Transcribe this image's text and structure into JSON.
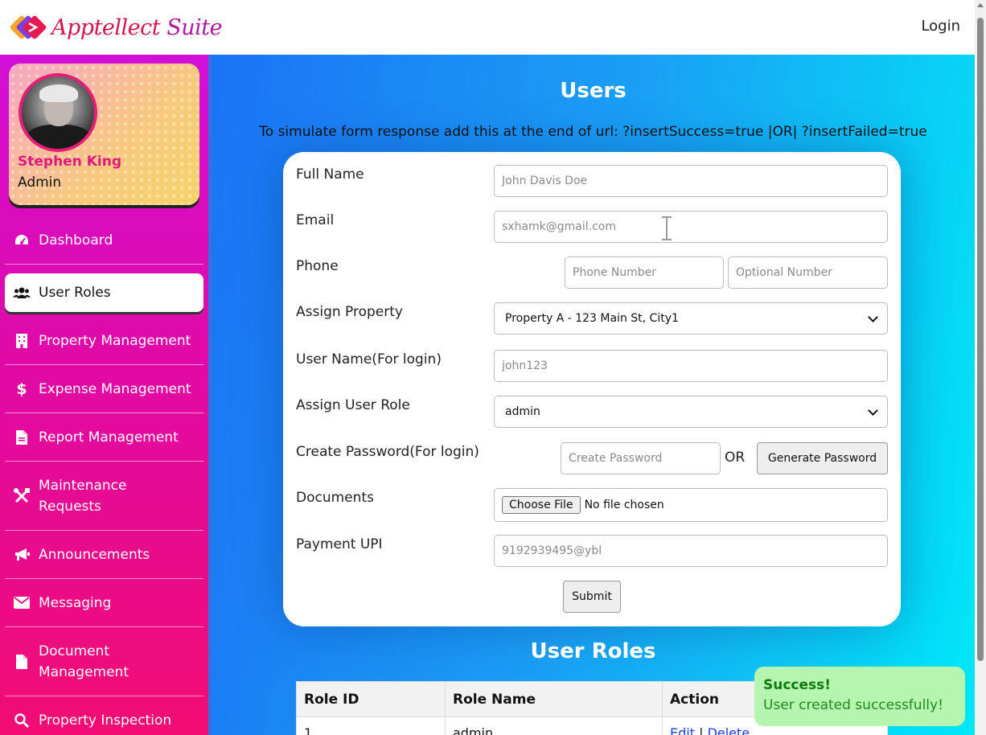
{
  "header": {
    "brand_main": "Apptellect",
    "brand_suite": "Suite",
    "login_label": "Login"
  },
  "profile": {
    "name": "Stephen King",
    "role": "Admin"
  },
  "sidebar": {
    "items": [
      {
        "label": "Dashboard",
        "icon": "gauge-icon",
        "active": false
      },
      {
        "label": "User Roles",
        "icon": "users-icon",
        "active": true
      },
      {
        "label": "Property Management",
        "icon": "building-icon",
        "active": false
      },
      {
        "label": "Expense Management",
        "icon": "dollar-icon",
        "active": false
      },
      {
        "label": "Report Management",
        "icon": "file-icon",
        "active": false
      },
      {
        "label": "Maintenance Requests",
        "icon": "tools-icon",
        "active": false
      },
      {
        "label": "Announcements",
        "icon": "megaphone-icon",
        "active": false
      },
      {
        "label": "Messaging",
        "icon": "envelope-icon",
        "active": false
      },
      {
        "label": "Document Management",
        "icon": "file-icon",
        "active": false
      },
      {
        "label": "Property Inspection",
        "icon": "search-icon",
        "active": false
      }
    ]
  },
  "main": {
    "title": "Users",
    "hint": "To simulate form response add this at the end of url: ?insertSuccess=true |OR| ?insertFailed=true"
  },
  "form": {
    "full_name": {
      "label": "Full Name",
      "placeholder": "John Davis Doe"
    },
    "email": {
      "label": "Email",
      "placeholder": "sxhamk@gmail.com"
    },
    "phone": {
      "label": "Phone",
      "placeholder_primary": "Phone Number",
      "placeholder_optional": "Optional Number"
    },
    "property": {
      "label": "Assign Property",
      "selected": "Property A - 123 Main St, City1"
    },
    "username": {
      "label": "User Name(For login)",
      "placeholder": "john123"
    },
    "user_role": {
      "label": "Assign User Role",
      "selected": "admin"
    },
    "password": {
      "label": "Create Password(For login)",
      "placeholder": "Create Password",
      "or_text": "OR",
      "generate_label": "Generate Password"
    },
    "documents": {
      "label": "Documents",
      "button_label": "Choose File",
      "status": "No file chosen"
    },
    "payment": {
      "label": "Payment UPI",
      "placeholder": "9192939495@ybl"
    },
    "submit_label": "Submit"
  },
  "roles": {
    "title": "User Roles",
    "columns": [
      "Role ID",
      "Role Name",
      "Action"
    ],
    "rows": [
      {
        "id": "1",
        "name": "admin",
        "edit": "Edit",
        "sep": "|",
        "delete": "Delete"
      }
    ]
  },
  "toast": {
    "title": "Success!",
    "message": "User created successfully!"
  },
  "colors": {
    "brand_red": "#d4154a",
    "brand_purple": "#b3179e",
    "sidebar_top": "#d20fd7",
    "sidebar_bottom": "#f20c73",
    "main_left": "#1b73f5",
    "main_right": "#00e8f7",
    "success_bg": "#b6f5b0",
    "success_text": "#0f7a0f"
  }
}
